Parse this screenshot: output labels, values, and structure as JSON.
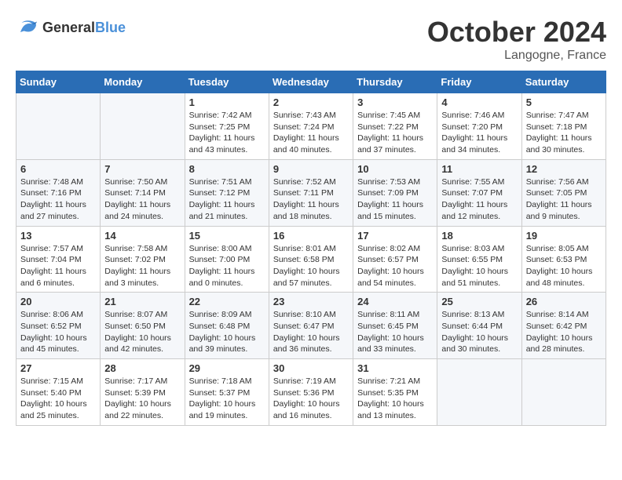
{
  "header": {
    "logo_line1": "General",
    "logo_line2": "Blue",
    "month": "October 2024",
    "location": "Langogne, France"
  },
  "days_of_week": [
    "Sunday",
    "Monday",
    "Tuesday",
    "Wednesday",
    "Thursday",
    "Friday",
    "Saturday"
  ],
  "weeks": [
    [
      {
        "day": "",
        "info": ""
      },
      {
        "day": "",
        "info": ""
      },
      {
        "day": "1",
        "info": "Sunrise: 7:42 AM\nSunset: 7:25 PM\nDaylight: 11 hours and 43 minutes."
      },
      {
        "day": "2",
        "info": "Sunrise: 7:43 AM\nSunset: 7:24 PM\nDaylight: 11 hours and 40 minutes."
      },
      {
        "day": "3",
        "info": "Sunrise: 7:45 AM\nSunset: 7:22 PM\nDaylight: 11 hours and 37 minutes."
      },
      {
        "day": "4",
        "info": "Sunrise: 7:46 AM\nSunset: 7:20 PM\nDaylight: 11 hours and 34 minutes."
      },
      {
        "day": "5",
        "info": "Sunrise: 7:47 AM\nSunset: 7:18 PM\nDaylight: 11 hours and 30 minutes."
      }
    ],
    [
      {
        "day": "6",
        "info": "Sunrise: 7:48 AM\nSunset: 7:16 PM\nDaylight: 11 hours and 27 minutes."
      },
      {
        "day": "7",
        "info": "Sunrise: 7:50 AM\nSunset: 7:14 PM\nDaylight: 11 hours and 24 minutes."
      },
      {
        "day": "8",
        "info": "Sunrise: 7:51 AM\nSunset: 7:12 PM\nDaylight: 11 hours and 21 minutes."
      },
      {
        "day": "9",
        "info": "Sunrise: 7:52 AM\nSunset: 7:11 PM\nDaylight: 11 hours and 18 minutes."
      },
      {
        "day": "10",
        "info": "Sunrise: 7:53 AM\nSunset: 7:09 PM\nDaylight: 11 hours and 15 minutes."
      },
      {
        "day": "11",
        "info": "Sunrise: 7:55 AM\nSunset: 7:07 PM\nDaylight: 11 hours and 12 minutes."
      },
      {
        "day": "12",
        "info": "Sunrise: 7:56 AM\nSunset: 7:05 PM\nDaylight: 11 hours and 9 minutes."
      }
    ],
    [
      {
        "day": "13",
        "info": "Sunrise: 7:57 AM\nSunset: 7:04 PM\nDaylight: 11 hours and 6 minutes."
      },
      {
        "day": "14",
        "info": "Sunrise: 7:58 AM\nSunset: 7:02 PM\nDaylight: 11 hours and 3 minutes."
      },
      {
        "day": "15",
        "info": "Sunrise: 8:00 AM\nSunset: 7:00 PM\nDaylight: 11 hours and 0 minutes."
      },
      {
        "day": "16",
        "info": "Sunrise: 8:01 AM\nSunset: 6:58 PM\nDaylight: 10 hours and 57 minutes."
      },
      {
        "day": "17",
        "info": "Sunrise: 8:02 AM\nSunset: 6:57 PM\nDaylight: 10 hours and 54 minutes."
      },
      {
        "day": "18",
        "info": "Sunrise: 8:03 AM\nSunset: 6:55 PM\nDaylight: 10 hours and 51 minutes."
      },
      {
        "day": "19",
        "info": "Sunrise: 8:05 AM\nSunset: 6:53 PM\nDaylight: 10 hours and 48 minutes."
      }
    ],
    [
      {
        "day": "20",
        "info": "Sunrise: 8:06 AM\nSunset: 6:52 PM\nDaylight: 10 hours and 45 minutes."
      },
      {
        "day": "21",
        "info": "Sunrise: 8:07 AM\nSunset: 6:50 PM\nDaylight: 10 hours and 42 minutes."
      },
      {
        "day": "22",
        "info": "Sunrise: 8:09 AM\nSunset: 6:48 PM\nDaylight: 10 hours and 39 minutes."
      },
      {
        "day": "23",
        "info": "Sunrise: 8:10 AM\nSunset: 6:47 PM\nDaylight: 10 hours and 36 minutes."
      },
      {
        "day": "24",
        "info": "Sunrise: 8:11 AM\nSunset: 6:45 PM\nDaylight: 10 hours and 33 minutes."
      },
      {
        "day": "25",
        "info": "Sunrise: 8:13 AM\nSunset: 6:44 PM\nDaylight: 10 hours and 30 minutes."
      },
      {
        "day": "26",
        "info": "Sunrise: 8:14 AM\nSunset: 6:42 PM\nDaylight: 10 hours and 28 minutes."
      }
    ],
    [
      {
        "day": "27",
        "info": "Sunrise: 7:15 AM\nSunset: 5:40 PM\nDaylight: 10 hours and 25 minutes."
      },
      {
        "day": "28",
        "info": "Sunrise: 7:17 AM\nSunset: 5:39 PM\nDaylight: 10 hours and 22 minutes."
      },
      {
        "day": "29",
        "info": "Sunrise: 7:18 AM\nSunset: 5:37 PM\nDaylight: 10 hours and 19 minutes."
      },
      {
        "day": "30",
        "info": "Sunrise: 7:19 AM\nSunset: 5:36 PM\nDaylight: 10 hours and 16 minutes."
      },
      {
        "day": "31",
        "info": "Sunrise: 7:21 AM\nSunset: 5:35 PM\nDaylight: 10 hours and 13 minutes."
      },
      {
        "day": "",
        "info": ""
      },
      {
        "day": "",
        "info": ""
      }
    ]
  ]
}
